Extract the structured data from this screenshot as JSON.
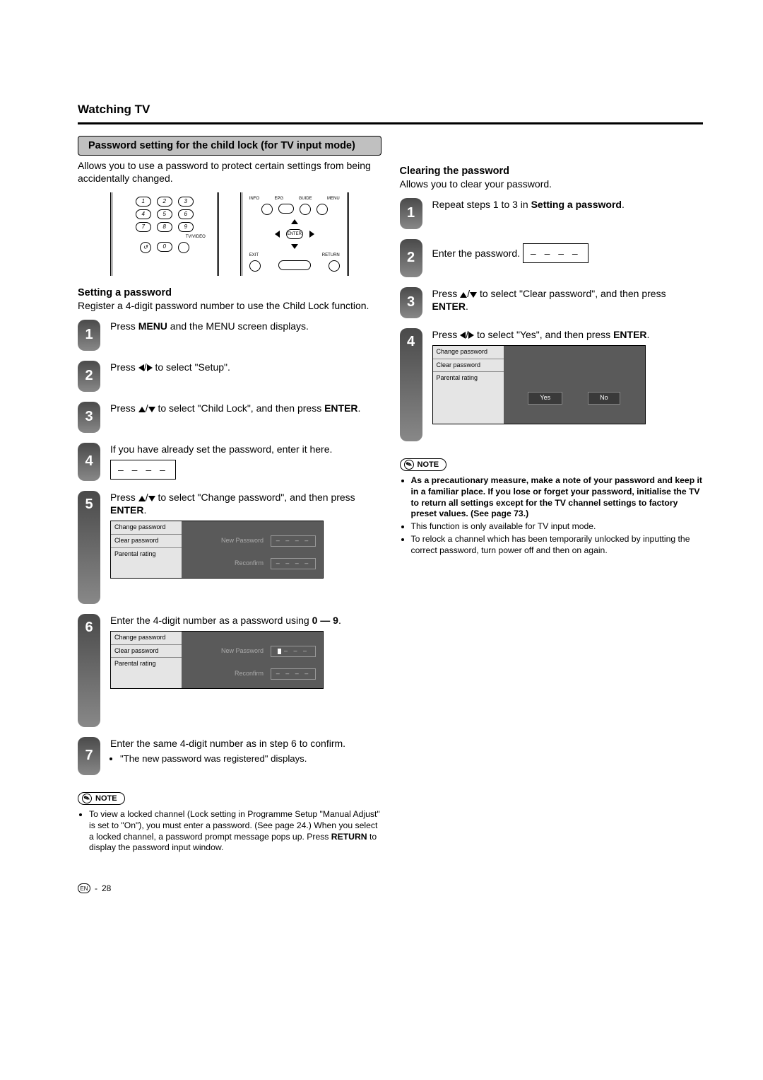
{
  "section_title": "Watching TV",
  "banner": "Password setting for the child lock (for TV input mode)",
  "intro": "Allows you to use a password to protect certain settings from being accidentally changed.",
  "remote_numpad": {
    "keys": [
      "1",
      "2",
      "3",
      "4",
      "5",
      "6",
      "7",
      "8",
      "9",
      "0"
    ],
    "labels": {
      "tvvideo": "TV/VIDEO"
    }
  },
  "remote_nav": {
    "info": "INFO",
    "epg": "EPG",
    "guide": "GUIDE",
    "menu": "MENU",
    "enter": "ENTER",
    "exit": "EXIT",
    "return": "RETURN"
  },
  "setting": {
    "heading": "Setting a password",
    "intro": "Register a 4-digit password number to use the Child Lock function.",
    "steps": {
      "1": {
        "pre": "Press ",
        "b1": "MENU",
        "post": " and the MENU screen displays."
      },
      "2": {
        "pre": "Press ",
        "post": " to select \"Setup\"."
      },
      "3": {
        "pre": "Press ",
        "mid": " to select \"Child Lock\", and then press ",
        "b1": "ENTER",
        "post": "."
      },
      "4": "If you have already set the password, enter it here.",
      "5": {
        "pre": "Press ",
        "mid": " to select \"Change password\", and then press ",
        "b1": "ENTER",
        "post": "."
      },
      "6": {
        "pre": "Enter the 4-digit number as a password using ",
        "b1": "0 — 9",
        "post": "."
      },
      "7": {
        "text": "Enter the same 4-digit number as in step 6 to confirm.",
        "bullet": "\"The new password was registered\" displays."
      }
    }
  },
  "panel": {
    "items": [
      "Change password",
      "Clear password",
      "Parental rating"
    ],
    "new_password": "New Password",
    "reconfirm": "Reconfirm",
    "dashes_plain": "– – – –",
    "dashes_cursor": "– – –",
    "yes": "Yes",
    "no": "No"
  },
  "note_label": "NOTE",
  "note_left": {
    "text_pre": "To view a locked channel (Lock setting in Programme Setup \"Manual Adjust\" is set to \"On\"), you must enter a password. (See page 24.) When you select a locked channel, a password prompt message pops up. Press ",
    "b1": "RETURN",
    "text_post": " to display the password input window."
  },
  "clearing": {
    "heading": "Clearing the password",
    "intro": "Allows you to clear your password.",
    "steps": {
      "1": {
        "pre": "Repeat steps 1 to 3 in ",
        "b1": "Setting a password",
        "post": "."
      },
      "2": "Enter the password.",
      "3": {
        "pre": "Press ",
        "mid": " to select \"Clear password\", and then press ",
        "b1": "ENTER",
        "post": "."
      },
      "4": {
        "pre": "Press ",
        "mid": " to select \"Yes\", and then press ",
        "b1": "ENTER",
        "post": "."
      }
    }
  },
  "note_right": {
    "b1": "As a precautionary measure, make a note of your password and keep it in a familiar place. If you lose or forget your password, initialise the TV to return all settings except for the TV channel settings to factory preset values. (See page 73.)",
    "b2": "This function is only available for TV input mode.",
    "b3": "To relock a channel which has been temporarily unlocked by inputting the correct password, turn power off and then on again."
  },
  "footer": {
    "lang": "EN",
    "page": "28"
  }
}
